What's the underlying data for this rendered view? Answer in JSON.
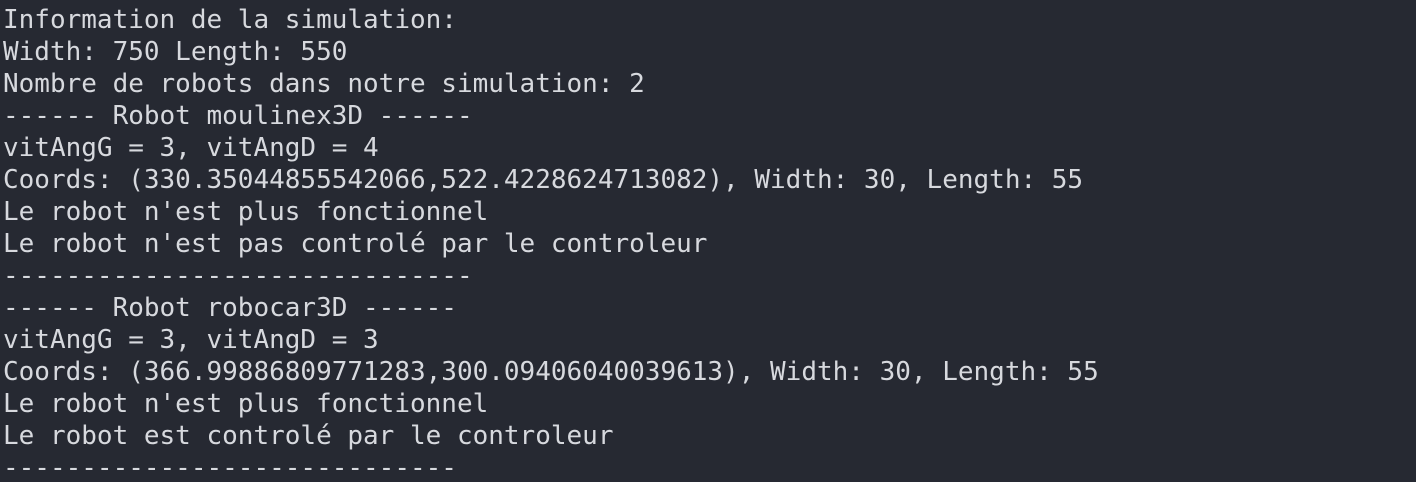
{
  "terminal": {
    "background": "#262932",
    "foreground": "#d7d9de",
    "lines": [
      "Information de la simulation:",
      "Width: 750 Length: 550",
      "Nombre de robots dans notre simulation: 2",
      "------ Robot moulinex3D ------",
      "vitAngG = 3, vitAngD = 4",
      "Coords: (330.35044855542066,522.4228624713082), Width: 30, Length: 55",
      "Le robot n'est plus fonctionnel",
      "Le robot n'est pas controlé par le controleur",
      "------------------------------",
      "------ Robot robocar3D ------",
      "vitAngG = 3, vitAngD = 3",
      "Coords: (366.99886809771283,300.09406040039613), Width: 30, Length: 55",
      "Le robot n'est plus fonctionnel",
      "Le robot est controlé par le controleur",
      "-----------------------------"
    ]
  }
}
